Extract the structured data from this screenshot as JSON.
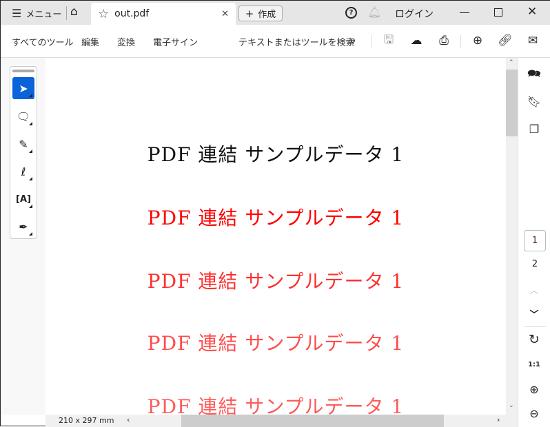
{
  "titlebar": {
    "menu_label": "メニュー",
    "tab_title": "out.pdf",
    "create_label": "作成",
    "login_label": "ログイン"
  },
  "toolbar": {
    "menus": [
      "すべてのツール",
      "編集",
      "変換",
      "電子サイン"
    ],
    "search_label": "テキストまたはツールを検索"
  },
  "document": {
    "lines": [
      {
        "text": "PDF 連結 サンプルデータ 1",
        "color": "#111111"
      },
      {
        "text": "PDF 連結 サンプルデータ 1",
        "color": "#ff0000"
      },
      {
        "text": "PDF 連結 サンプルデータ 1",
        "color": "#ff3030"
      },
      {
        "text": "PDF 連結 サンプルデータ 1",
        "color": "#ff4c4c"
      },
      {
        "text": "PDF 連結 サンプルデータ 1",
        "color": "#ff5a5a"
      }
    ],
    "page_size": "210 x 297 mm"
  },
  "pages": {
    "current": "1",
    "next": "2"
  },
  "accent": "#0a63d9"
}
